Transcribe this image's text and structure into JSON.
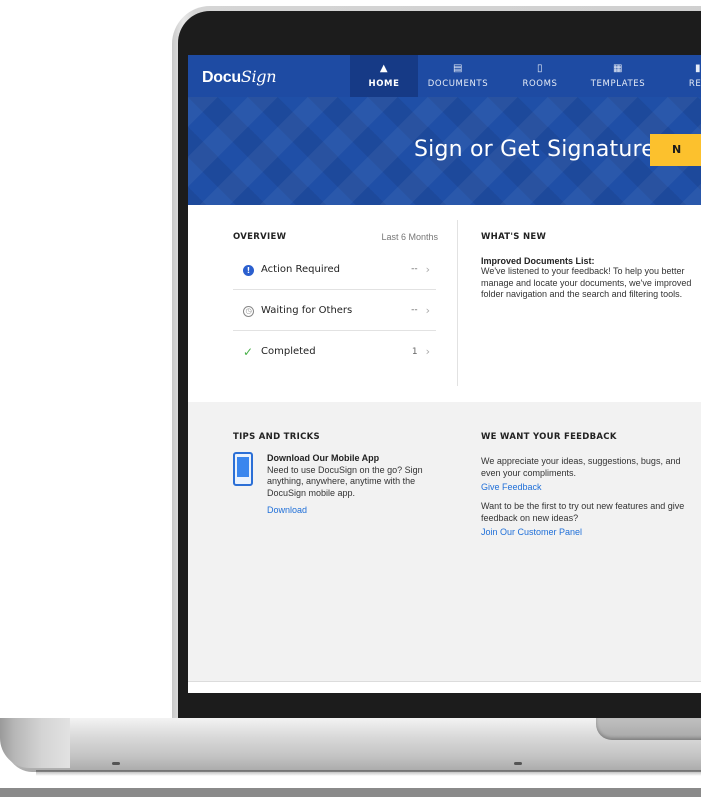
{
  "navbar": {
    "logo_prefix": "Docu",
    "logo_script": "Sign",
    "items": [
      {
        "label": "HOME",
        "icon": "home-icon",
        "active": true
      },
      {
        "label": "DOCUMENTS",
        "icon": "documents-icon"
      },
      {
        "label": "ROOMS",
        "icon": "rooms-icon"
      },
      {
        "label": "TEMPLATES",
        "icon": "templates-icon"
      },
      {
        "label": "REP",
        "icon": "reports-icon"
      }
    ]
  },
  "hero": {
    "title": "Sign or Get Signatures",
    "cta_label": "N",
    "cta_color": "#fcc12d"
  },
  "overview": {
    "heading": "OVERVIEW",
    "range": "Last 6 Months",
    "rows": [
      {
        "label": "Action Required",
        "count": "--",
        "icon": "exclamation-icon"
      },
      {
        "label": "Waiting for Others",
        "count": "--",
        "icon": "clock-icon"
      },
      {
        "label": "Completed",
        "count": "1",
        "icon": "checkmark-icon"
      }
    ]
  },
  "whats_new": {
    "heading": "WHAT'S NEW",
    "title": "Improved Documents List:",
    "body": "We've listened to your feedback! To help you better manage and locate your documents, we've improved folder navigation and the search and filtering tools."
  },
  "tips": {
    "heading": "TIPS AND TRICKS",
    "title": "Download Our Mobile App",
    "body": "Need to use DocuSign on the go? Sign anything, anywhere, anytime with the DocuSign mobile app.",
    "link": "Download"
  },
  "feedback": {
    "heading": "WE WANT YOUR FEEDBACK",
    "text1": "We appreciate your ideas, suggestions, bugs, and even your compliments.",
    "link1": "Give Feedback",
    "text2": "Want to be the first to try out new features and give feedback on new ideas?",
    "link2": "Join Our Customer Panel"
  },
  "colors": {
    "brand_blue": "#1e4ba3",
    "accent_yellow": "#fcc12d",
    "link_blue": "#1f6fd8",
    "success_green": "#4ab04a"
  }
}
